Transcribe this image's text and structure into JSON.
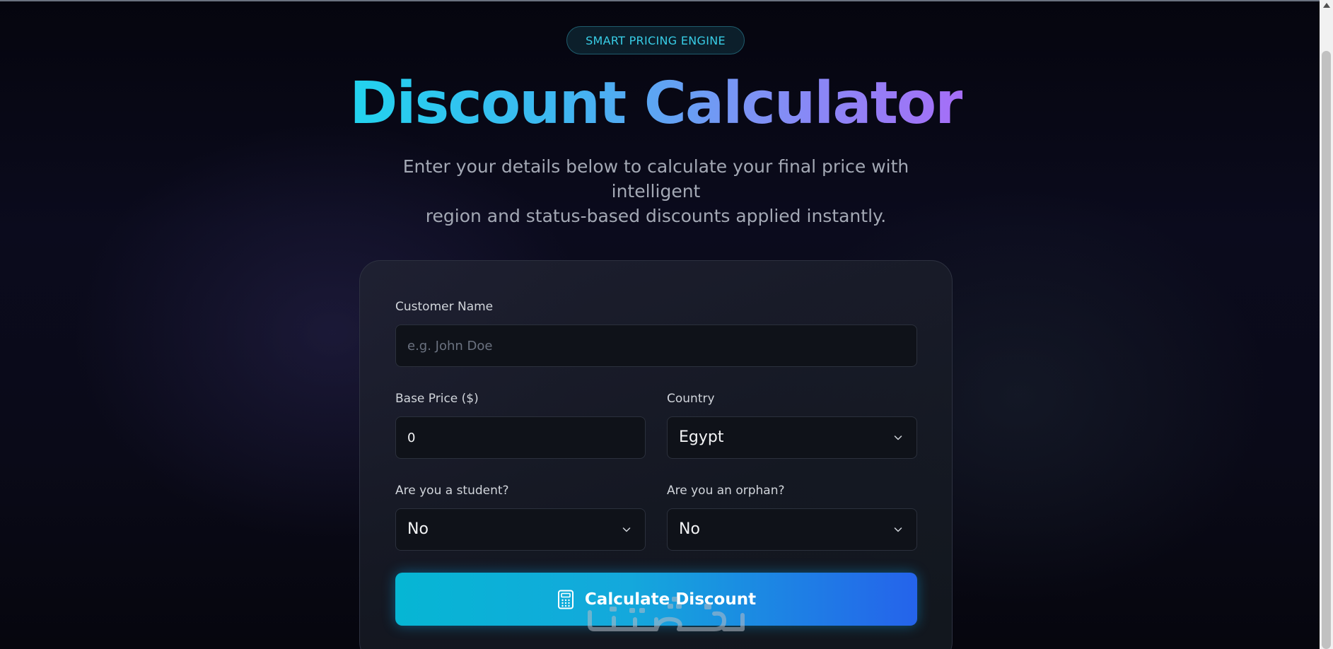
{
  "header": {
    "badge": "SMART PRICING ENGINE",
    "title": "Discount Calculator",
    "subtitle_line1": "Enter your details below to calculate your final price with intelligent",
    "subtitle_line2": "region and status-based discounts applied instantly."
  },
  "form": {
    "customer_name": {
      "label": "Customer Name",
      "placeholder": "e.g. John Doe",
      "value": ""
    },
    "base_price": {
      "label": "Base Price ($)",
      "value": "0"
    },
    "country": {
      "label": "Country",
      "selected": "Egypt"
    },
    "student": {
      "label": "Are you a student?",
      "selected": "No"
    },
    "orphan": {
      "label": "Are you an orphan?",
      "selected": "No"
    },
    "submit_label": "Calculate Discount"
  },
  "icons": {
    "select_chevron": "chevron-down-icon",
    "submit": "calculator-icon",
    "watermark": "watermark-logo"
  },
  "colors": {
    "accent_cyan": "#22d3ee",
    "accent_purple": "#a66ef7",
    "button_start": "#06b6d4",
    "button_end": "#2563eb"
  }
}
